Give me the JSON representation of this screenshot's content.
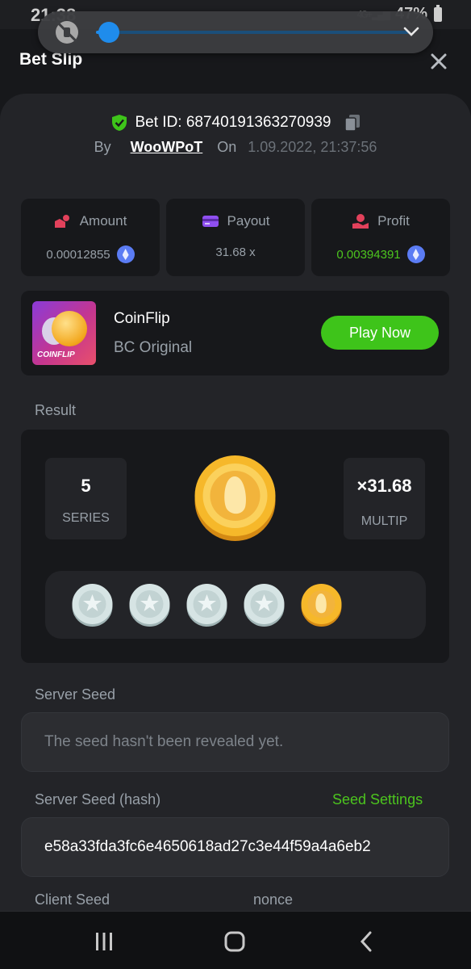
{
  "status_bar": {
    "time": "21:38",
    "network": "4G+",
    "battery": "47%"
  },
  "volume": {
    "level": 0.04
  },
  "header": {
    "title": "Bet Slip"
  },
  "bet": {
    "id_text": "Bet ID: 6874019136327093​9",
    "by_label": "By",
    "username": "WooWPoT",
    "on_label": "On",
    "date": "1.09.2022, 21:37:56"
  },
  "stats": {
    "amount_label": "Amount",
    "amount_value": "0.00012855",
    "payout_label": "Payout",
    "payout_value": "31.68 x",
    "profit_label": "Profit",
    "profit_value": "0.00394391"
  },
  "game": {
    "thumb_label": "COINFLIP",
    "name": "CoinFlip",
    "subtitle": "BC Original",
    "play_label": "Play Now"
  },
  "result": {
    "label": "Result",
    "series_value": "5",
    "series_label": "SERIES",
    "multip_value": "×31.68",
    "multip_label": "MULTIP",
    "coins": [
      "silver",
      "silver",
      "silver",
      "silver",
      "gold"
    ]
  },
  "server_seed": {
    "label": "Server Seed",
    "value": "The seed hasn't been revealed yet."
  },
  "server_seed_hash": {
    "label": "Server Seed (hash)",
    "settings_label": "Seed Settings",
    "value": "e58a33fda3fc6e4650618ad27c3e44f59a4a6eb2"
  },
  "client_seed": {
    "label": "Client Seed",
    "nonce_label": "nonce"
  },
  "colors": {
    "accent_green": "#3ec41a",
    "slider_blue": "#1f8cec",
    "eth_purple": "#5b7cf4"
  }
}
